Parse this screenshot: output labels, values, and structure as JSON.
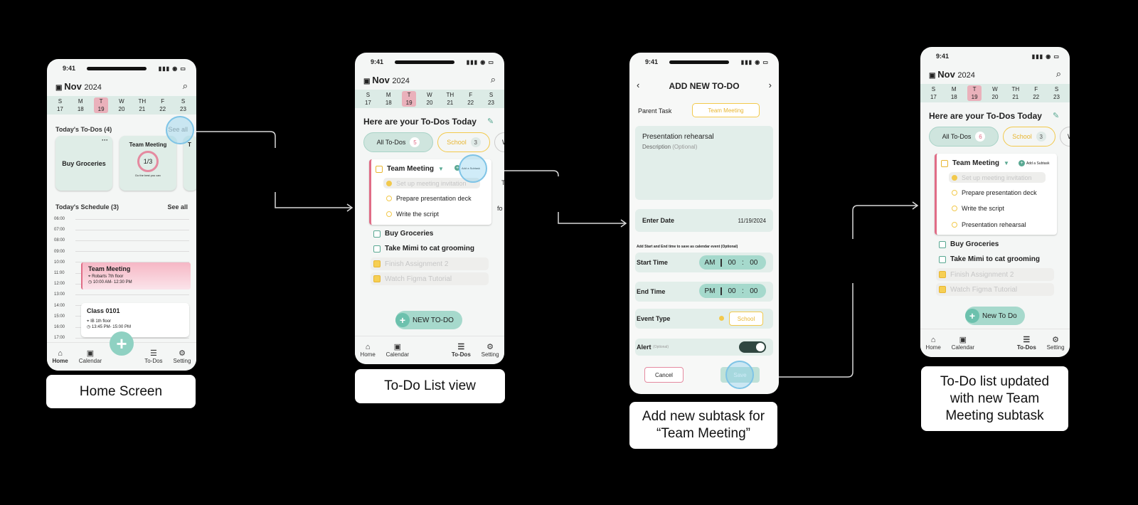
{
  "status_time": "9:41",
  "status_icons": "▮▮▮ ◉ ▭",
  "header": {
    "month": "Nov",
    "year": "2024"
  },
  "week": {
    "days": [
      "S",
      "M",
      "T",
      "W",
      "TH",
      "F",
      "S"
    ],
    "dates": [
      "17",
      "18",
      "19",
      "20",
      "21",
      "22",
      "23"
    ]
  },
  "home": {
    "todos_title": "Today's To-Dos (4)",
    "see_all": "See all",
    "card1": "Buy Groceries",
    "card2": "Team Meeting",
    "card2_progress": "1/3",
    "card2_motto": "Do the best you can",
    "card3_peek": "T",
    "schedule_title": "Today's Schedule (3)",
    "schedule_see_all": "See all",
    "hours": [
      "06:00",
      "07:00",
      "08:00",
      "09:00",
      "10:00",
      "11:00",
      "12:00",
      "13:00",
      "14:00",
      "15:00",
      "16:00",
      "17:00"
    ],
    "ev1": {
      "title": "Team Meeting",
      "loc": "Robarts 7th floor",
      "time": "10:00 AM- 12:30 PM"
    },
    "ev2": {
      "title": "Class 0101",
      "loc": "IB 1th floor",
      "time": "13:45 PM- 15:00 PM"
    }
  },
  "nav": {
    "home": "Home",
    "calendar": "Calendar",
    "todos": "To-Dos",
    "setting": "Setting"
  },
  "list": {
    "title": "Here are your To-Dos Today",
    "chip_all": "All To-Dos",
    "chip_all_count": "5",
    "chip_all_count_updated": "6",
    "chip_school": "School",
    "chip_school_count": "3",
    "chip_peek": "W",
    "team": "Team Meeting",
    "add_subtask": "Add a Subtask",
    "subs": [
      "Set up meeting invitation",
      "Prepare presentation deck",
      "Write the script"
    ],
    "new_sub": "Presentation rehearsal",
    "tasks": [
      "Buy Groceries",
      "Take Mimi to cat grooming"
    ],
    "done": [
      "Finish Assignment 2",
      "Watch Figma Tutorial"
    ],
    "new_btn": "NEW TO-DO",
    "new_btn2": "New To Do",
    "peek1": "T",
    "peek2": "fo"
  },
  "form": {
    "title": "ADD NEW TO-DO",
    "parent_label": "Parent Task",
    "parent_value": "Team Meeting",
    "name": "Presentation rehearsal",
    "desc": "Description",
    "desc_opt": "(Optional)",
    "date_label": "Enter Date",
    "date_value": "11/19/2024",
    "hint": "Add Start and End time to save as calendar event (Optional)",
    "start_label": "Start Time",
    "start_ampm": "AM",
    "start_h": "00",
    "start_m": "00",
    "end_label": "End Time",
    "end_ampm": "PM",
    "end_h": "00",
    "end_m": "00",
    "type_label": "Event Type",
    "type_value": "School",
    "alert_label": "Alert",
    "alert_opt": "(Optional)",
    "cancel": "Cancel",
    "save": "Save"
  },
  "captions": {
    "c1": "Home Screen",
    "c2": "To-Do List view",
    "c3": "Add new subtask for “Team Meeting”",
    "c4": "To-Do list updated with new Team Meeting subtask"
  },
  "colors": {
    "accent": "#8fd1c2",
    "pink": "#e06c86",
    "yellow": "#f2c94c"
  }
}
